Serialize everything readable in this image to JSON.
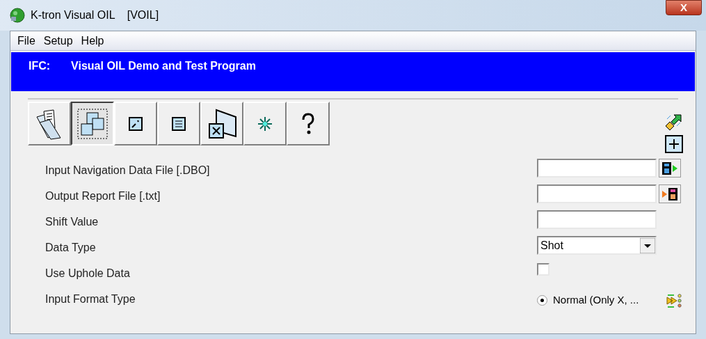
{
  "window": {
    "title": "K-tron Visual OIL    [VOIL]",
    "close": "X"
  },
  "menu": [
    "File",
    "Setup",
    "Help"
  ],
  "banner": {
    "label": "IFC:",
    "title": "Visual OIL Demo and Test Program"
  },
  "toolbar": [
    {
      "selected": false
    },
    {
      "selected": true
    },
    {
      "selected": false
    },
    {
      "selected": false
    },
    {
      "selected": false
    },
    {
      "selected": false
    },
    {
      "selected": false
    }
  ],
  "fields": [
    {
      "kind": "file",
      "label": "Input Navigation Data File [.DBO]"
    },
    {
      "kind": "file",
      "label": "Output Report File [.txt]"
    },
    {
      "kind": "text",
      "label": "Shift Value"
    },
    {
      "kind": "dropdown",
      "label": "Data Type",
      "value": "Shot"
    },
    {
      "kind": "checkbox",
      "label": "Use Uphole Data",
      "checked": false
    },
    {
      "kind": "radio",
      "label": "Input Format Type",
      "option": "Normal (Only X, ...",
      "selected": true
    }
  ]
}
